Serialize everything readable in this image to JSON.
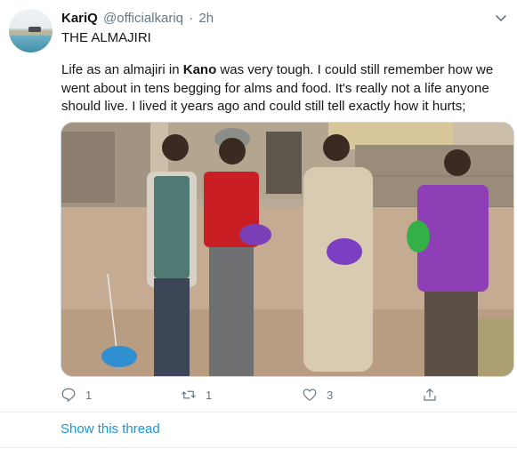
{
  "tweet": {
    "author_name": "KariQ",
    "handle": "@officialkariq",
    "separator": "·",
    "time": "2h",
    "headline": "THE ALMAJIRI",
    "body_part1": "Life as an almajiri in ",
    "body_bold": "Kano",
    "body_part2": " was very tough. I could still remember how we went about in tens begging for alms and food. It's really not a life anyone should live. I lived it years ago and could still tell exactly how it hurts;",
    "media_image": "photo of four boys walking on a dirt road holding bowls",
    "actions": {
      "reply_icon": "reply-icon",
      "reply_count": "1",
      "retweet_icon": "retweet-icon",
      "retweet_count": "1",
      "like_icon": "heart-icon",
      "like_count": "3",
      "share_icon": "share-icon"
    }
  },
  "show_thread": "Show this thread",
  "colors": {
    "link": "#1b95e0",
    "secondary_text": "#657786",
    "border": "#e6ecf0"
  }
}
